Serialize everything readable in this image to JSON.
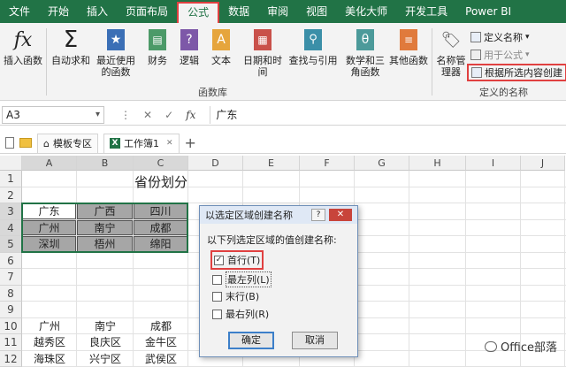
{
  "ribbon_tabs": [
    "文件",
    "开始",
    "插入",
    "页面布局",
    "公式",
    "数据",
    "审阅",
    "视图",
    "美化大师",
    "开发工具",
    "Power BI"
  ],
  "active_tab_index": 4,
  "ribbon": {
    "insert_function": "插入函数",
    "autosum": "自动求和",
    "recent": "最近使用的函数",
    "financial": "财务",
    "logical": "逻辑",
    "text": "文本",
    "datetime": "日期和时间",
    "lookup": "查找与引用",
    "math": "数学和三角函数",
    "more": "其他函数",
    "group_library": "函数库",
    "name_manager": "名称管理器",
    "define_name": "定义名称",
    "use_in_formula": "用于公式",
    "create_from_selection": "根据所选内容创建",
    "group_defined_names": "定义的名称"
  },
  "formula_bar": {
    "name_box": "A3",
    "fx": "fx",
    "content": "广东"
  },
  "doc_tabs": {
    "template": "模板专区",
    "workbook": "工作簿1",
    "add": "+"
  },
  "columns": [
    "A",
    "B",
    "C",
    "D",
    "E",
    "F",
    "G",
    "H",
    "I",
    "J"
  ],
  "rows": [
    "1",
    "2",
    "3",
    "4",
    "5",
    "6",
    "7",
    "8",
    "9",
    "10",
    "11",
    "12"
  ],
  "sheet": {
    "title": "省份划分",
    "table": [
      [
        "广东",
        "广西",
        "四川"
      ],
      [
        "广州",
        "南宁",
        "成都"
      ],
      [
        "深圳",
        "梧州",
        "绵阳"
      ]
    ],
    "lower_header": [
      "广州",
      "南宁",
      "成都"
    ],
    "lower_row11": [
      "越秀区",
      "良庆区",
      "金牛区"
    ],
    "lower_row12": [
      "海珠区",
      "兴宁区",
      "武侯区"
    ]
  },
  "dialog": {
    "title": "以选定区域创建名称",
    "help": "?",
    "close": "✕",
    "prompt": "以下列选定区域的值创建名称:",
    "options": [
      {
        "label": "首行(T)",
        "checked": true
      },
      {
        "label": "最左列(L)",
        "checked": false
      },
      {
        "label": "末行(B)",
        "checked": false
      },
      {
        "label": "最右列(R)",
        "checked": false
      }
    ],
    "ok": "确定",
    "cancel": "取消"
  },
  "watermark": "Office部落",
  "colors": {
    "excel_green": "#217346",
    "highlight_red": "#e04040",
    "selection_fill": "#a6a6a6"
  }
}
